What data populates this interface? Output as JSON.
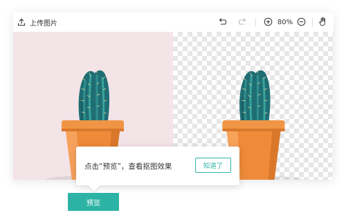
{
  "toolbar": {
    "upload_label": "上传图片",
    "zoom": "80%"
  },
  "icons": {
    "upload": "upload-icon",
    "undo": "undo-icon",
    "redo": "redo-icon",
    "zoom_in": "zoom-in-icon",
    "zoom_out": "zoom-out-icon",
    "hand": "hand-pan-icon"
  },
  "tooltip": {
    "text": "点击“预览”，查看抠图效果",
    "button": "知道了"
  },
  "preview_button": "预览",
  "colors": {
    "accent": "#2db3a5",
    "original_background": "#f3e4e8",
    "pot": "#ef8a3a"
  }
}
